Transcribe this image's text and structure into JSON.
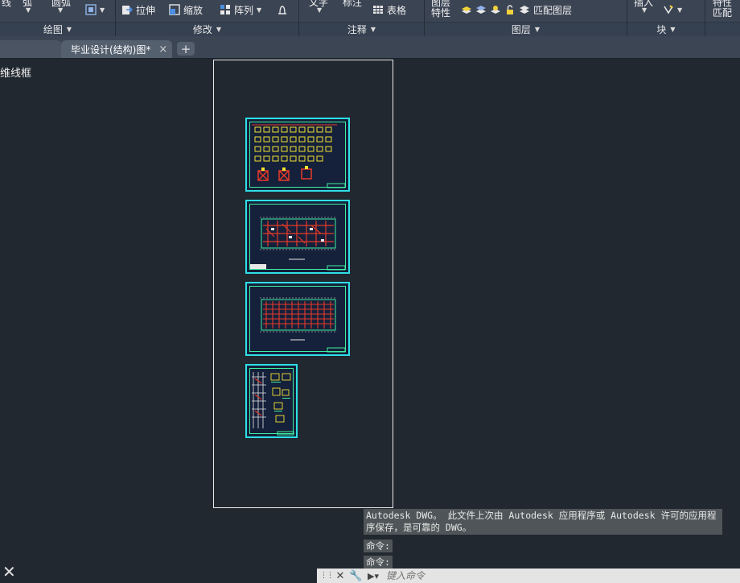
{
  "ribbon": {
    "panels": [
      {
        "label": "绘图"
      },
      {
        "label": "修改"
      },
      {
        "label": "注释"
      },
      {
        "label": "图层"
      },
      {
        "label": "块"
      }
    ],
    "modify_tools": [
      {
        "label": "拉伸"
      },
      {
        "label": "缩放"
      },
      {
        "label": "阵列"
      }
    ],
    "annot_table": "表格",
    "layer_props": "特性",
    "layer_match": "匹配图层",
    "right_match": "匹配"
  },
  "tabs": {
    "document": "毕业设计(结构)图*",
    "add": "+",
    "close": "×"
  },
  "viewport": {
    "label": "维线框"
  },
  "command": {
    "history": "Autodesk DWG。  此文件上次由 Autodesk 应用程序或 Autodesk 许可的应用程序保存，是可靠的 DWG。",
    "prompt1": "命令:",
    "prompt2": "命令:",
    "placeholder": "键入命令"
  },
  "colors": {
    "background": "#212830",
    "ribbon": "#3b4453",
    "drawing_frame": "#2ee0e6",
    "drawing_red": "#e43a2a",
    "drawing_yellow": "#f2e233"
  }
}
